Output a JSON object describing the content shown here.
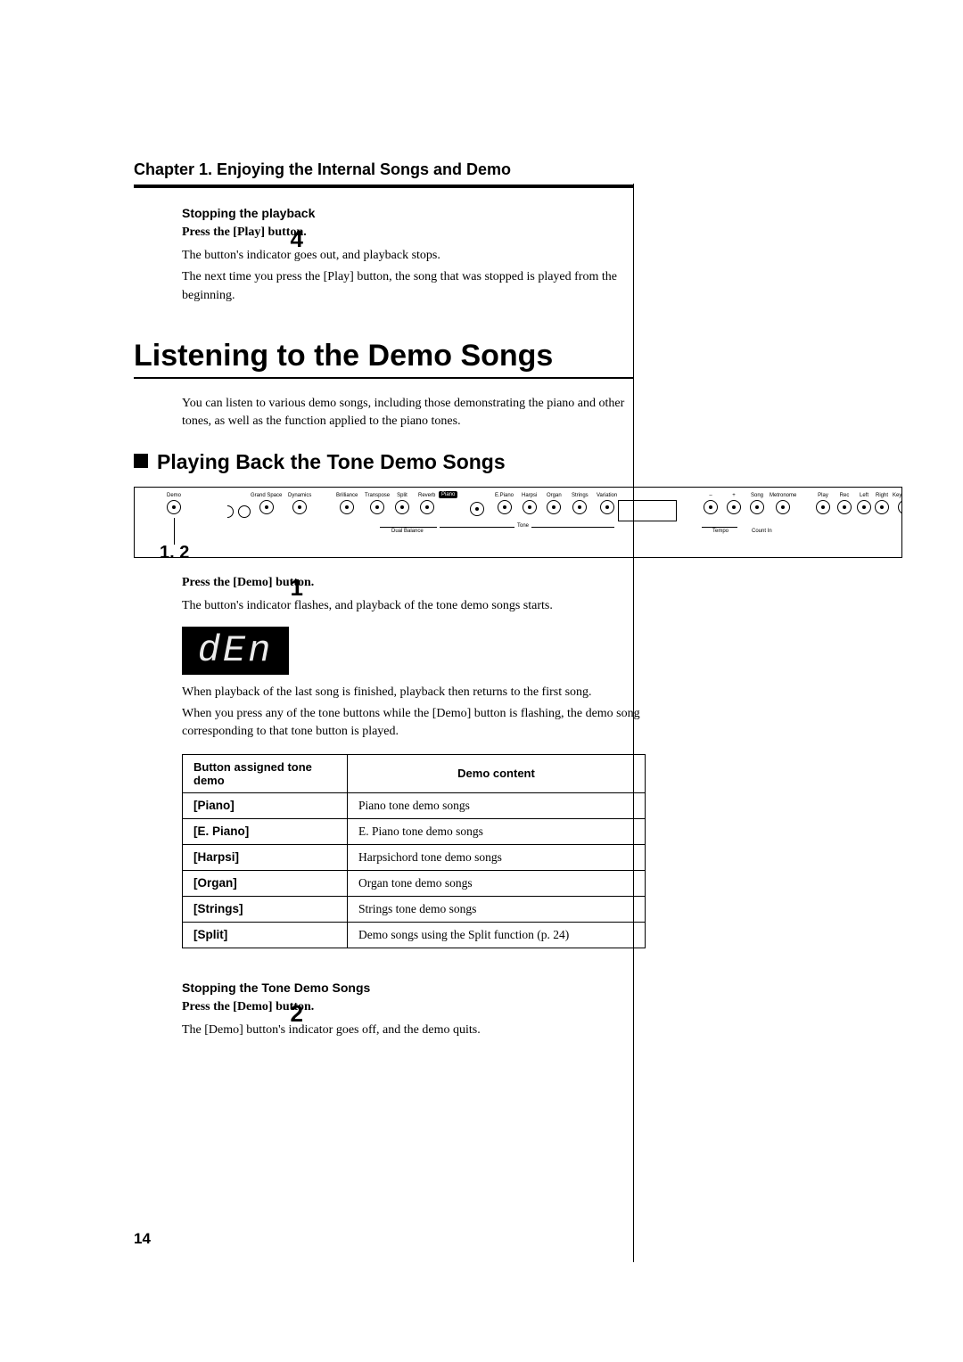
{
  "chapter": {
    "title": "Chapter 1. Enjoying the Internal Songs and Demo"
  },
  "stop_playback": {
    "heading": "Stopping the playback",
    "step_num": "4",
    "instr": "Press the [Play] button.",
    "p1": "The button's indicator goes out, and playback stops.",
    "p2": "The next time you press the [Play] button, the song that was stopped is played from the beginning."
  },
  "section": {
    "title": "Listening to the Demo Songs",
    "intro": "You can listen to various demo songs, including those demonstrating the piano and other tones, as well as the function applied to the piano tones."
  },
  "sub": {
    "title": "Playing Back the Tone Demo Songs"
  },
  "panel": {
    "callout": "1, 2",
    "labels": {
      "demo": "Demo",
      "grand": "Grand Space",
      "dyn": "Dynamics",
      "bril": "Brilliance",
      "trans": "Transpose",
      "split": "Split",
      "reverb": "Reverb",
      "piano": "Piano",
      "epiano": "E.Piano",
      "harpsi": "Harpsi",
      "organ": "Organ",
      "strings": "Strings",
      "variation": "Variation",
      "minus": "–",
      "plus": "+",
      "song": "Song",
      "metro": "Metronome",
      "play": "Play",
      "rec": "Rec",
      "left": "Left",
      "right": "Right",
      "key": "Key Touch",
      "tone": "Tone",
      "dual": "Dual Balance",
      "tempo": "Tempo",
      "countin": "Count In"
    }
  },
  "step1": {
    "num": "1",
    "instr": "Press the [Demo] button.",
    "p1": "The button's indicator flashes, and playback of the tone demo songs starts.",
    "lcd": "dEn",
    "p2": "When playback of the last song is finished, playback then returns to the first song.",
    "p3": "When you press any of the tone buttons while the [Demo] button is flashing, the demo song corresponding to that tone button is played."
  },
  "table": {
    "h1": "Button assigned tone demo",
    "h2": "Demo content",
    "rows": [
      {
        "k": "[Piano]",
        "v": "Piano tone demo songs"
      },
      {
        "k": "[E. Piano]",
        "v": "E. Piano tone demo songs"
      },
      {
        "k": "[Harpsi]",
        "v": "Harpsichord tone demo songs"
      },
      {
        "k": "[Organ]",
        "v": "Organ tone demo songs"
      },
      {
        "k": "[Strings]",
        "v": "Strings tone demo songs"
      },
      {
        "k": "[Split]",
        "v": "Demo songs using the Split function (p. 24)"
      }
    ]
  },
  "stop_demo": {
    "heading": "Stopping the Tone Demo Songs",
    "num": "2",
    "instr": "Press the [Demo] button.",
    "p1": "The [Demo] button's indicator goes off, and the demo quits."
  },
  "page_number": "14"
}
